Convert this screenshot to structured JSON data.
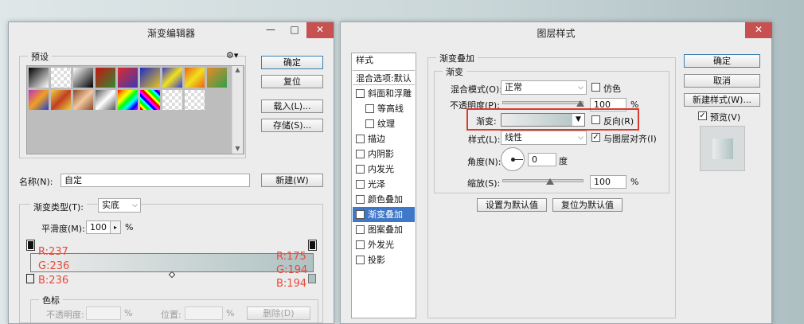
{
  "gradient_editor": {
    "title": "渐变编辑器",
    "controls": {
      "minimize": "—",
      "maximize": "□",
      "close": "✕"
    },
    "presets_legend": "预设",
    "buttons": {
      "ok": "确定",
      "reset": "复位",
      "load": "载入(L)...",
      "save": "存储(S)...",
      "new": "新建(W)",
      "delete": "删除(D)"
    },
    "name_label": "名称(N):",
    "name_value": "自定",
    "type_label": "渐变类型(T):",
    "type_value": "实底",
    "smooth_label": "平滑度(M):",
    "smooth_value": "100",
    "smooth_unit": "%",
    "left_stop": {
      "r": "R:237",
      "g": "G:236",
      "b": "B:236",
      "color": "#edecec"
    },
    "right_stop": {
      "r": "R:175",
      "g": "G:194",
      "b": "B:194",
      "color": "#afc2c2"
    },
    "stops_legend": "色标",
    "opacity_label": "不透明度:",
    "opacity_unit": "%",
    "location_label": "位置:",
    "location_unit": "%",
    "annotation_color": "#e84a3c"
  },
  "layer_style": {
    "title": "图层样式",
    "controls": {
      "close": "✕"
    },
    "style_list": [
      {
        "label": "样式",
        "checkbox": false,
        "checked": false,
        "selected": false
      },
      {
        "label": "混合选项:默认",
        "checkbox": false,
        "checked": false,
        "selected": false
      },
      {
        "label": "斜面和浮雕",
        "checkbox": true,
        "checked": false,
        "selected": false
      },
      {
        "label": "等高线",
        "checkbox": true,
        "checked": false,
        "selected": false
      },
      {
        "label": "纹理",
        "checkbox": true,
        "checked": false,
        "selected": false
      },
      {
        "label": "描边",
        "checkbox": true,
        "checked": false,
        "selected": false
      },
      {
        "label": "内阴影",
        "checkbox": true,
        "checked": false,
        "selected": false
      },
      {
        "label": "内发光",
        "checkbox": true,
        "checked": false,
        "selected": false
      },
      {
        "label": "光泽",
        "checkbox": true,
        "checked": false,
        "selected": false
      },
      {
        "label": "颜色叠加",
        "checkbox": true,
        "checked": false,
        "selected": false
      },
      {
        "label": "渐变叠加",
        "checkbox": true,
        "checked": true,
        "selected": true
      },
      {
        "label": "图案叠加",
        "checkbox": true,
        "checked": false,
        "selected": false
      },
      {
        "label": "外发光",
        "checkbox": true,
        "checked": false,
        "selected": false
      },
      {
        "label": "投影",
        "checkbox": true,
        "checked": false,
        "selected": false
      }
    ],
    "section_title": "渐变叠加",
    "group_title": "渐变",
    "blend_label": "混合模式(O):",
    "blend_value": "正常",
    "dither_label": "仿色",
    "opacity_label": "不透明度(P):",
    "opacity_value": "100",
    "opacity_unit": "%",
    "gradient_label": "渐变:",
    "reverse_label": "反向(R)",
    "style_label": "样式(L):",
    "style_value": "线性",
    "align_label": "与图层对齐(I)",
    "angle_label": "角度(N):",
    "angle_value": "0",
    "angle_unit": "度",
    "scale_label": "缩放(S):",
    "scale_value": "100",
    "scale_unit": "%",
    "set_default": "设置为默认值",
    "reset_default": "复位为默认值",
    "buttons": {
      "ok": "确定",
      "cancel": "取消",
      "new_style": "新建样式(W)...",
      "preview": "预览(V)"
    },
    "highlight_color": "#d93a2f"
  }
}
